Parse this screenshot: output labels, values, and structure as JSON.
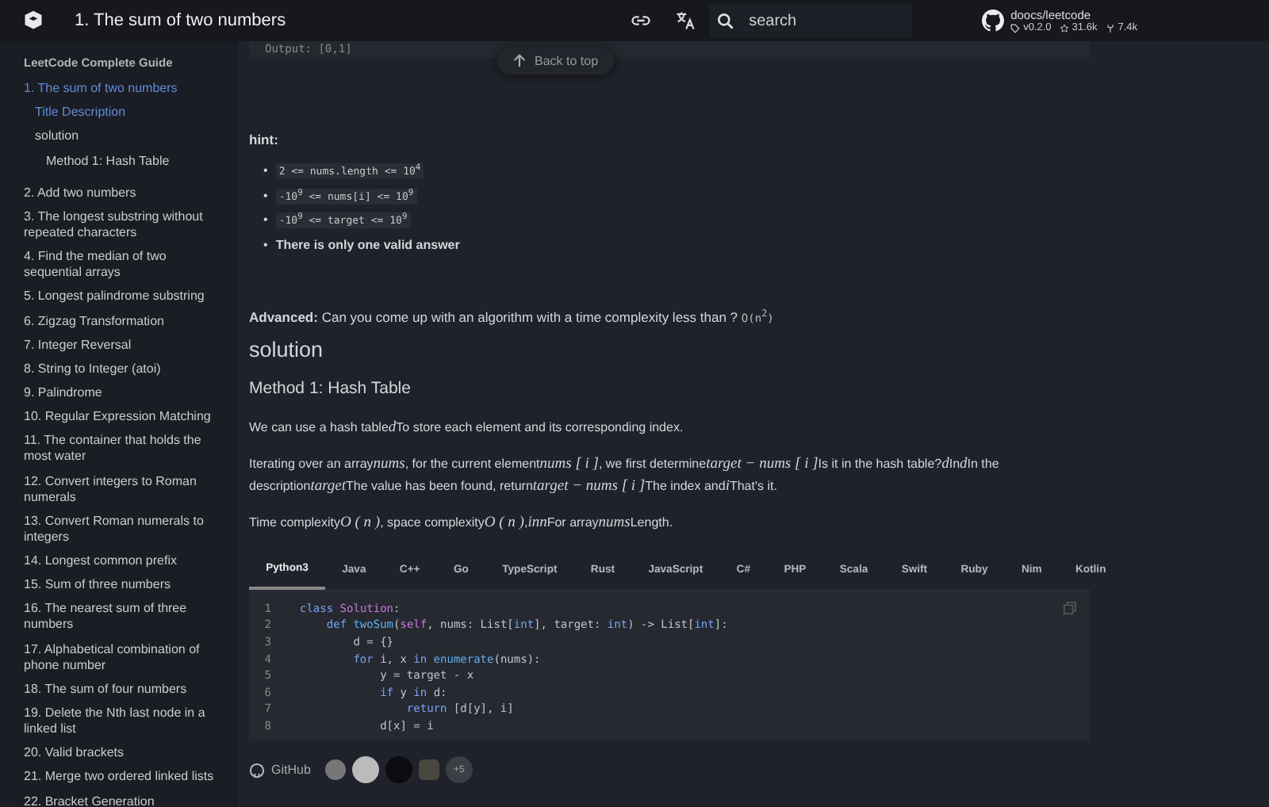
{
  "header": {
    "title": "1. The sum of two numbers",
    "search": {
      "placeholder": "search"
    },
    "repo": {
      "name": "doocs/leetcode",
      "version": "v0.2.0",
      "stars": "31.6k",
      "forks": "7.4k"
    }
  },
  "sidebar": {
    "title": "LeetCode Complete Guide",
    "items": [
      {
        "label": "1. The sum of two numbers",
        "selected": true,
        "children": [
          {
            "label": "Title Description",
            "selected": true
          },
          {
            "label": "solution",
            "selected": false,
            "children": [
              {
                "label": "Method 1: Hash Table",
                "selected": false
              }
            ]
          }
        ]
      },
      {
        "label": "2. Add two numbers",
        "selected": false
      },
      {
        "label": "3. The longest substring without repeated characters",
        "selected": false
      },
      {
        "label": "4. Find the median of two sequential arrays",
        "selected": false
      },
      {
        "label": "5. Longest palindrome substring",
        "selected": false
      },
      {
        "label": "6. Zigzag Transformation",
        "selected": false
      },
      {
        "label": "7. Integer Reversal",
        "selected": false
      },
      {
        "label": "8. String to Integer (atoi)",
        "selected": false
      },
      {
        "label": "9. Palindrome",
        "selected": false
      },
      {
        "label": "10. Regular Expression Matching",
        "selected": false
      },
      {
        "label": "11. The container that holds the most water",
        "selected": false
      },
      {
        "label": "12. Convert integers to Roman numerals",
        "selected": false
      },
      {
        "label": "13. Convert Roman numerals to integers",
        "selected": false
      },
      {
        "label": "14. Longest common prefix",
        "selected": false
      },
      {
        "label": "15. Sum of three numbers",
        "selected": false
      },
      {
        "label": "16. The nearest sum of three numbers",
        "selected": false
      },
      {
        "label": "17. Alphabetical combination of phone number",
        "selected": false
      },
      {
        "label": "18. The sum of four numbers",
        "selected": false
      },
      {
        "label": "19. Delete the Nth last node in a linked list",
        "selected": false
      },
      {
        "label": "20. Valid brackets",
        "selected": false
      },
      {
        "label": "21. Merge two ordered linked lists",
        "selected": false
      },
      {
        "label": "22. Bracket Generation",
        "selected": false
      }
    ]
  },
  "content": {
    "output_snippet": "Output: [0,1]",
    "back_to_top": "Back to top",
    "hint_title": "hint:",
    "hints": [
      {
        "kind": "code",
        "bullet": "•",
        "text": "2 <= nums.length <= 10$^{4}$"
      },
      {
        "kind": "code",
        "bullet": "•",
        "text": "-10$^{9}$ <= nums[i] <= 10$^{9}$"
      },
      {
        "kind": "code",
        "bullet": "•",
        "text": "-10$^{9}$ <= target <= 10$^{9}$"
      },
      {
        "kind": "bold",
        "bullet": "•",
        "text": "There is only one valid answer"
      }
    ],
    "advanced": {
      "label": "Advanced:",
      "text": "Can you come up with an algorithm with a time complexity less than ?",
      "code": "O(n$^{2}$)"
    },
    "solution_heading": "solution",
    "method_heading": "Method 1: Hash Table",
    "paragraphs": [
      [
        {
          "kind": "text",
          "t": "We can use a hash table"
        },
        {
          "kind": "math",
          "t": "d"
        },
        {
          "kind": "text",
          "t": "To store each element and its corresponding index."
        }
      ],
      [
        {
          "kind": "text",
          "t": "Iterating over an array"
        },
        {
          "kind": "math",
          "t": "nums"
        },
        {
          "kind": "text",
          "t": ", for the current element"
        },
        {
          "kind": "math",
          "t": "nums [ i ]"
        },
        {
          "kind": "text",
          "t": ", we first determine"
        },
        {
          "kind": "math",
          "t": "target − nums [ i ]"
        },
        {
          "kind": "text",
          "t": "Is it in the hash table?"
        },
        {
          "kind": "math",
          "t": "d"
        },
        {
          "kind": "text",
          "t": "In"
        },
        {
          "kind": "math",
          "t": "d"
        },
        {
          "kind": "text",
          "t": "In the description"
        },
        {
          "kind": "math",
          "t": "target"
        },
        {
          "kind": "text",
          "t": "The value has been found, return"
        },
        {
          "kind": "math",
          "t": "target − nums [ i ]"
        },
        {
          "kind": "text",
          "t": "The index and"
        },
        {
          "kind": "math",
          "t": "i"
        },
        {
          "kind": "text",
          "t": "That's it."
        }
      ],
      [
        {
          "kind": "text",
          "t": "Time complexity"
        },
        {
          "kind": "math",
          "t": "O ( n )"
        },
        {
          "kind": "text",
          "t": ", space complexity"
        },
        {
          "kind": "math",
          "t": "O ( n )"
        },
        {
          "kind": "text",
          "t": ","
        },
        {
          "kind": "math",
          "t": "inn"
        },
        {
          "kind": "text",
          "t": "For array"
        },
        {
          "kind": "math",
          "t": "nums"
        },
        {
          "kind": "text",
          "t": "Length."
        }
      ]
    ],
    "tabs": [
      {
        "label": "Python3",
        "selected": true
      },
      {
        "label": "Java",
        "selected": false
      },
      {
        "label": "C++",
        "selected": false
      },
      {
        "label": "Go",
        "selected": false
      },
      {
        "label": "TypeScript",
        "selected": false
      },
      {
        "label": "Rust",
        "selected": false
      },
      {
        "label": "JavaScript",
        "selected": false
      },
      {
        "label": "C#",
        "selected": false
      },
      {
        "label": "PHP",
        "selected": false
      },
      {
        "label": "Scala",
        "selected": false
      },
      {
        "label": "Swift",
        "selected": false
      },
      {
        "label": "Ruby",
        "selected": false
      },
      {
        "label": "Nim",
        "selected": false
      },
      {
        "label": "Kotlin",
        "selected": false
      }
    ],
    "code": [
      {
        "number": "1",
        "tokens": [
          {
            "kind": "kw",
            "t": "class "
          },
          {
            "kind": "cls",
            "t": "Solution"
          },
          {
            "kind": "p",
            "t": ":"
          }
        ]
      },
      {
        "number": "2",
        "tokens": [
          {
            "kind": "kw",
            "t": "    def "
          },
          {
            "kind": "fn",
            "t": "twoSum"
          },
          {
            "kind": "p",
            "t": "("
          },
          {
            "kind": "cls",
            "t": "self"
          },
          {
            "kind": "p",
            "t": ", nums: List["
          },
          {
            "kind": "kw",
            "t": "int"
          },
          {
            "kind": "p",
            "t": "], target: "
          },
          {
            "kind": "kw",
            "t": "int"
          },
          {
            "kind": "p",
            "t": ") -> List["
          },
          {
            "kind": "kw",
            "t": "int"
          },
          {
            "kind": "p",
            "t": "]:"
          }
        ]
      },
      {
        "number": "3",
        "tokens": [
          {
            "kind": "p",
            "t": "        d = {}"
          }
        ]
      },
      {
        "number": "4",
        "tokens": [
          {
            "kind": "kw",
            "t": "        for"
          },
          {
            "kind": "p",
            "t": " i, x "
          },
          {
            "kind": "kw",
            "t": "in"
          },
          {
            "kind": "fn",
            "t": " enumerate"
          },
          {
            "kind": "p",
            "t": "(nums):"
          }
        ]
      },
      {
        "number": "5",
        "tokens": [
          {
            "kind": "p",
            "t": "            y = target - x"
          }
        ]
      },
      {
        "number": "6",
        "tokens": [
          {
            "kind": "kw",
            "t": "            if"
          },
          {
            "kind": "p",
            "t": " y "
          },
          {
            "kind": "kw",
            "t": "in"
          },
          {
            "kind": "p",
            "t": " d:"
          }
        ]
      },
      {
        "number": "7",
        "tokens": [
          {
            "kind": "kw",
            "t": "                return"
          },
          {
            "kind": "p",
            "t": " [d[y], i]"
          }
        ]
      },
      {
        "number": "8",
        "tokens": [
          {
            "kind": "p",
            "t": "            d[x] = i"
          }
        ]
      }
    ],
    "footer": {
      "github": "GitHub",
      "more_contributors": "+5"
    }
  }
}
